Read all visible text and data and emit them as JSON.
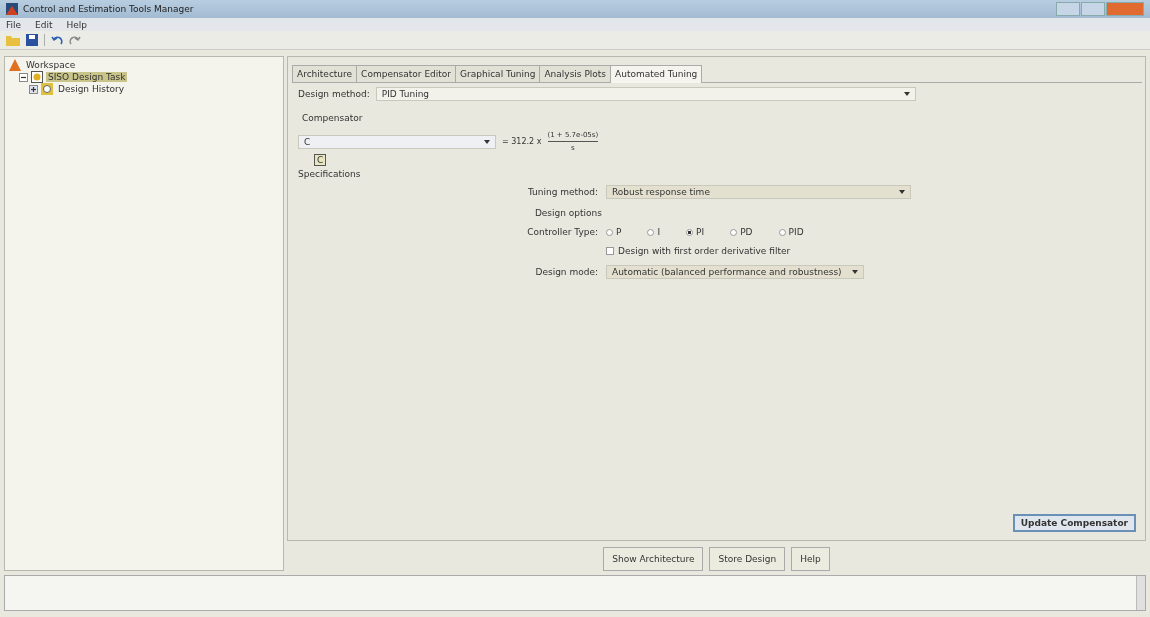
{
  "window": {
    "title": "Control and Estimation Tools Manager"
  },
  "menu": [
    "File",
    "Edit",
    "Help"
  ],
  "tree": [
    {
      "label": "Workspace",
      "kind": "workspace",
      "selected": false,
      "children": [
        {
          "label": "SISO Design Task",
          "kind": "task",
          "selected": true,
          "expanded": true,
          "children": [
            {
              "label": "Design History",
              "kind": "history",
              "selected": false,
              "expanded": false
            }
          ]
        }
      ]
    }
  ],
  "tabs": [
    {
      "label": "Architecture",
      "selected": false
    },
    {
      "label": "Compensator Editor",
      "selected": false
    },
    {
      "label": "Graphical Tuning",
      "selected": false
    },
    {
      "label": "Analysis Plots",
      "selected": false
    },
    {
      "label": "Automated Tuning",
      "selected": true
    }
  ],
  "design_method": {
    "label": "Design method:",
    "value": "PID Tuning"
  },
  "compensator": {
    "label": "Compensator",
    "value": "C",
    "gain": "= 312.2 x",
    "numerator": "(1 + 5.7e-05s)",
    "denominator": "s",
    "block": "C"
  },
  "specifications_label": "Specifications",
  "tuning_method": {
    "label": "Tuning method:",
    "value": "Robust response time"
  },
  "design_options_label": "Design options",
  "controller_type": {
    "label": "Controller Type:",
    "options": [
      {
        "label": "P",
        "selected": false
      },
      {
        "label": "I",
        "selected": false
      },
      {
        "label": "PI",
        "selected": true
      },
      {
        "label": "PD",
        "selected": false
      },
      {
        "label": "PID",
        "selected": false
      }
    ]
  },
  "derivative_filter": {
    "label": "Design with first order derivative filter",
    "checked": false
  },
  "design_mode": {
    "label": "Design mode:",
    "value": "Automatic (balanced performance and robustness)"
  },
  "update_button": "Update Compensator",
  "bottom_buttons": [
    "Show Architecture",
    "Store Design",
    "Help"
  ]
}
